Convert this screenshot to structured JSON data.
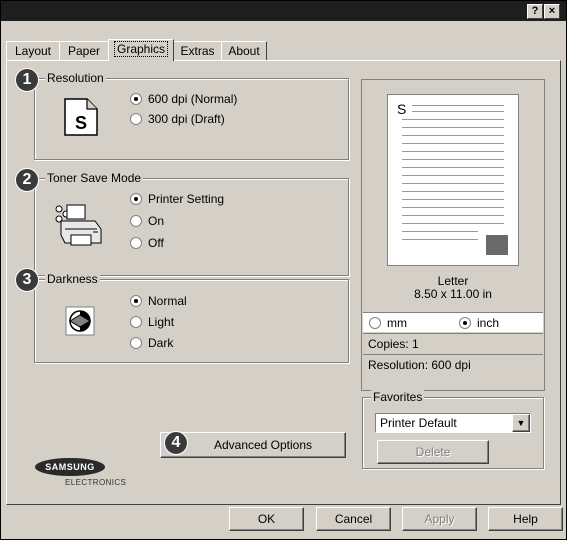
{
  "window": {
    "help_button": "?",
    "close_button": "×"
  },
  "tabs": [
    "Layout",
    "Paper",
    "Graphics",
    "Extras",
    "About"
  ],
  "resolution": {
    "badge": "1",
    "title": "Resolution",
    "options": [
      "600 dpi (Normal)",
      "300 dpi (Draft)"
    ],
    "selected": "600 dpi (Normal)"
  },
  "toner": {
    "badge": "2",
    "title": "Toner Save Mode",
    "options": [
      "Printer Setting",
      "On",
      "Off"
    ],
    "selected": "Printer Setting"
  },
  "darkness": {
    "badge": "3",
    "title": "Darkness",
    "options": [
      "Normal",
      "Light",
      "Dark"
    ],
    "selected": "Normal"
  },
  "advanced": {
    "badge": "4",
    "label": "Advanced Options"
  },
  "preview": {
    "paper_glyph": "S",
    "paper_name": "Letter",
    "paper_size": "8.50 x 11.00 in",
    "unit_mm": "mm",
    "unit_inch": "inch",
    "selected_unit": "inch",
    "copies": "Copies: 1",
    "resolution": "Resolution: 600 dpi"
  },
  "favorites": {
    "title": "Favorites",
    "selected": "Printer Default",
    "delete_label": "Delete"
  },
  "logo": {
    "brand": "SAMSUNG",
    "sub": "ELECTRONICS"
  },
  "footer": {
    "ok": "OK",
    "cancel": "Cancel",
    "apply": "Apply",
    "help": "Help"
  },
  "colors": {
    "badge": "#3a3a3a",
    "titlebar": "#1e1e1e",
    "dialog": "#d4d0c8"
  }
}
